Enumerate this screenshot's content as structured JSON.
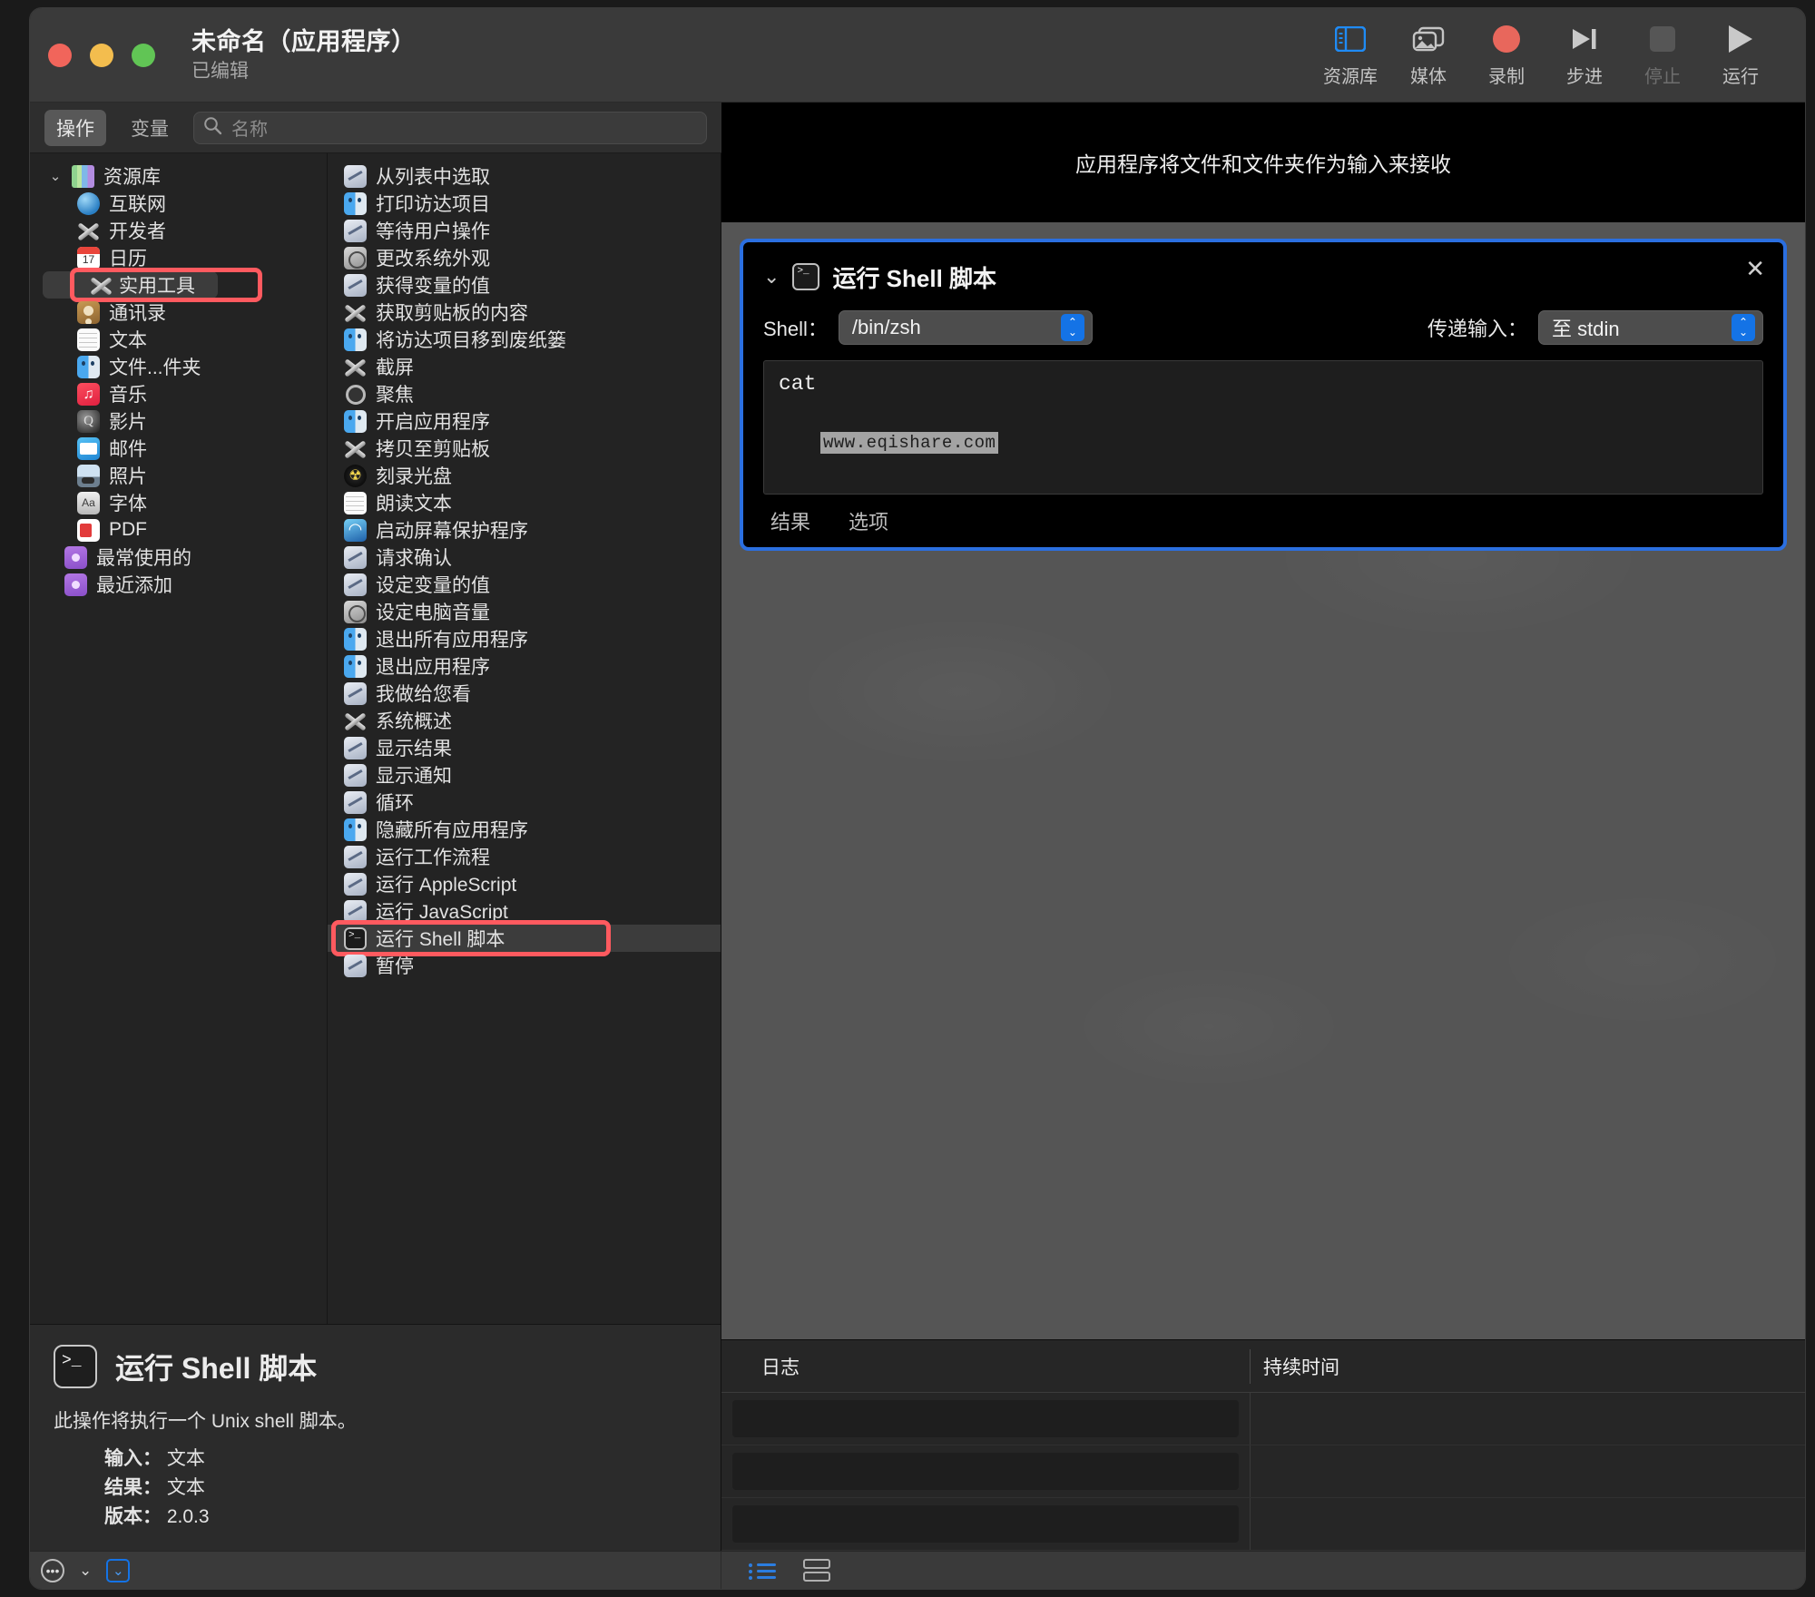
{
  "window": {
    "title": "未命名（应用程序）",
    "subtitle": "已编辑"
  },
  "toolbar": {
    "buttons": [
      {
        "label": "资源库",
        "icon": "sidebar-icon",
        "state": "active"
      },
      {
        "label": "媒体",
        "icon": "media-icon",
        "state": "normal"
      },
      {
        "label": "录制",
        "icon": "record-icon",
        "state": "normal"
      },
      {
        "label": "步进",
        "icon": "step-icon",
        "state": "normal"
      },
      {
        "label": "停止",
        "icon": "stop-icon",
        "state": "disabled"
      },
      {
        "label": "运行",
        "icon": "play-icon",
        "state": "normal"
      }
    ]
  },
  "subbar": {
    "tab_actions": "操作",
    "tab_variables": "变量",
    "search_placeholder": "名称",
    "search_value": "",
    "search_icon": "search-icon"
  },
  "library_tree": {
    "root": {
      "label": "资源库",
      "icon": "library-icon",
      "expanded": true
    },
    "items": [
      {
        "label": "互联网",
        "icon": "internet-icon"
      },
      {
        "label": "开发者",
        "icon": "xtool-icon"
      },
      {
        "label": "日历",
        "icon": "calendar-icon"
      },
      {
        "label": "实用工具",
        "icon": "xtool-icon",
        "selected": true,
        "highlighted": true
      },
      {
        "label": "通讯录",
        "icon": "contacts-icon"
      },
      {
        "label": "文本",
        "icon": "textedit-icon"
      },
      {
        "label": "文件...件夹",
        "icon": "finder-icon"
      },
      {
        "label": "音乐",
        "icon": "music-icon"
      },
      {
        "label": "影片",
        "icon": "quicktime-icon"
      },
      {
        "label": "邮件",
        "icon": "mail-icon"
      },
      {
        "label": "照片",
        "icon": "photos-icon"
      },
      {
        "label": "字体",
        "icon": "fontbook-icon"
      },
      {
        "label": "PDF",
        "icon": "pdf-icon"
      }
    ],
    "smart_folders": [
      {
        "label": "最常使用的",
        "icon": "smart-folder-icon"
      },
      {
        "label": "最近添加",
        "icon": "smart-folder-icon"
      }
    ]
  },
  "actions_list": [
    {
      "label": "从列表中选取",
      "icon": "automator-icon"
    },
    {
      "label": "打印访达项目",
      "icon": "finder-icon"
    },
    {
      "label": "等待用户操作",
      "icon": "automator-icon"
    },
    {
      "label": "更改系统外观",
      "icon": "sysprefs-icon"
    },
    {
      "label": "获得变量的值",
      "icon": "automator-icon"
    },
    {
      "label": "获取剪贴板的内容",
      "icon": "xtool-icon"
    },
    {
      "label": "将访达项目移到废纸篓",
      "icon": "finder-icon"
    },
    {
      "label": "截屏",
      "icon": "xtool-icon"
    },
    {
      "label": "聚焦",
      "icon": "magnifier-icon"
    },
    {
      "label": "开启应用程序",
      "icon": "finder-icon"
    },
    {
      "label": "拷贝至剪贴板",
      "icon": "xtool-icon"
    },
    {
      "label": "刻录光盘",
      "icon": "burn-icon"
    },
    {
      "label": "朗读文本",
      "icon": "textedit-icon"
    },
    {
      "label": "启动屏幕保护程序",
      "icon": "screensaver-icon"
    },
    {
      "label": "请求确认",
      "icon": "automator-icon"
    },
    {
      "label": "设定变量的值",
      "icon": "automator-icon"
    },
    {
      "label": "设定电脑音量",
      "icon": "sysprefs-icon"
    },
    {
      "label": "退出所有应用程序",
      "icon": "finder-icon"
    },
    {
      "label": "退出应用程序",
      "icon": "finder-icon"
    },
    {
      "label": "我做给您看",
      "icon": "automator-icon"
    },
    {
      "label": "系统概述",
      "icon": "xtool-icon"
    },
    {
      "label": "显示结果",
      "icon": "automator-icon"
    },
    {
      "label": "显示通知",
      "icon": "automator-icon"
    },
    {
      "label": "循环",
      "icon": "automator-icon"
    },
    {
      "label": "隐藏所有应用程序",
      "icon": "finder-icon"
    },
    {
      "label": "运行工作流程",
      "icon": "automator-icon"
    },
    {
      "label": "运行 AppleScript",
      "icon": "automator-icon"
    },
    {
      "label": "运行 JavaScript",
      "icon": "automator-icon"
    },
    {
      "label": "运行 Shell 脚本",
      "icon": "terminal-icon",
      "selected": true,
      "highlighted": true
    },
    {
      "label": "暂停",
      "icon": "automator-icon"
    }
  ],
  "info_panel": {
    "icon": "terminal-icon",
    "title": "运行 Shell 脚本",
    "description": "此操作将执行一个 Unix shell 脚本。",
    "fields": [
      {
        "label": "输入：",
        "value": "文本"
      },
      {
        "label": "结果：",
        "value": "文本"
      },
      {
        "label": "版本：",
        "value": "2.0.3"
      }
    ]
  },
  "workflow": {
    "header_text": "应用程序将文件和文件夹作为输入来接收",
    "action_card": {
      "icon": "terminal-icon",
      "title": "运行 Shell 脚本",
      "collapse_chevron": "chevron-down-icon",
      "close_icon": "close-icon",
      "shell_label": "Shell：",
      "shell_value": "/bin/zsh",
      "pass_input_label": "传递输入：",
      "pass_input_value": "至 stdin",
      "script_text": "cat",
      "watermark": "www.eqishare.com",
      "tabs": [
        {
          "label": "结果"
        },
        {
          "label": "选项"
        }
      ]
    }
  },
  "log_panel": {
    "col_log": "日志",
    "col_duration": "持续时间",
    "rows": [
      "",
      "",
      ""
    ]
  },
  "bottom_bar": {
    "options_icon": "ellipsis-icon",
    "options_chevron": "chevron-down-icon",
    "toggle_icon": "chevron-down-boxed-icon",
    "list_view_icon": "list-view-icon",
    "split_view_icon": "split-view-icon"
  },
  "colors": {
    "accent_blue": "#1473e6",
    "selection_red": "#ff5a5f",
    "record_red": "#e8675c"
  }
}
